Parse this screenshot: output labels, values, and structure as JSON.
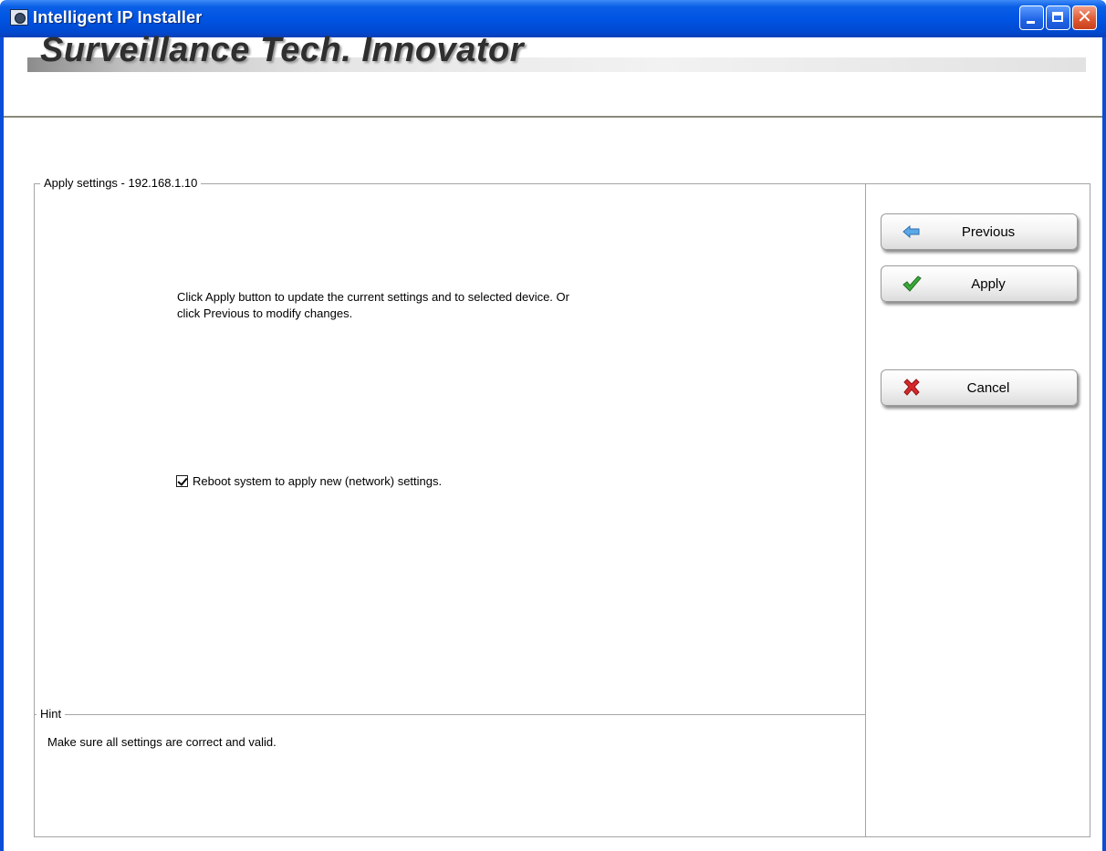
{
  "window": {
    "title": "Intelligent IP Installer"
  },
  "banner": {
    "text": "Surveillance Tech. Innovator"
  },
  "main": {
    "group_title": "Apply settings - 192.168.1.10",
    "instruction_line1": "Click Apply button to update the current settings and to selected device. Or",
    "instruction_line2": "click Previous to modify changes.",
    "reboot_checkbox": {
      "label": "Reboot system to apply  new (network) settings.",
      "checked": true
    },
    "hint_title": "Hint",
    "hint_text": "Make sure all settings are correct and valid."
  },
  "buttons": {
    "previous": {
      "label": "Previous",
      "icon": "left-arrow-icon"
    },
    "apply": {
      "label": "Apply",
      "icon": "checkmark-icon"
    },
    "cancel": {
      "label": "Cancel",
      "icon": "x-icon"
    }
  },
  "colors": {
    "titlebar": "#0054e3",
    "close_button": "#e05a33",
    "checkmark": "#3aa83a",
    "cancel_x": "#d8282a",
    "arrow": "#5aa8e8"
  }
}
